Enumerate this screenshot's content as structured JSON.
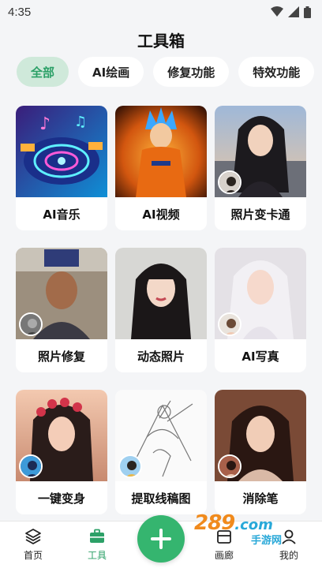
{
  "status": {
    "time": "4:35"
  },
  "title": "工具箱",
  "chips": [
    {
      "label": "全部",
      "active": true
    },
    {
      "label": "AI绘画"
    },
    {
      "label": "修复功能"
    },
    {
      "label": "特效功能"
    }
  ],
  "tools": [
    {
      "label": "AI音乐"
    },
    {
      "label": "AI视频"
    },
    {
      "label": "照片变卡通"
    },
    {
      "label": "照片修复"
    },
    {
      "label": "动态照片"
    },
    {
      "label": "AI写真"
    },
    {
      "label": "一键变身"
    },
    {
      "label": "提取线稿图"
    },
    {
      "label": "消除笔"
    }
  ],
  "tabbar": {
    "home": "首页",
    "tools": "工具",
    "gallery": "画廊",
    "mine": "我的"
  },
  "watermark": {
    "main": "289",
    "domain": ".com",
    "sub": "手游网"
  },
  "colors": {
    "accent": "#35b56f",
    "chip_active_bg": "#cfe9da"
  }
}
